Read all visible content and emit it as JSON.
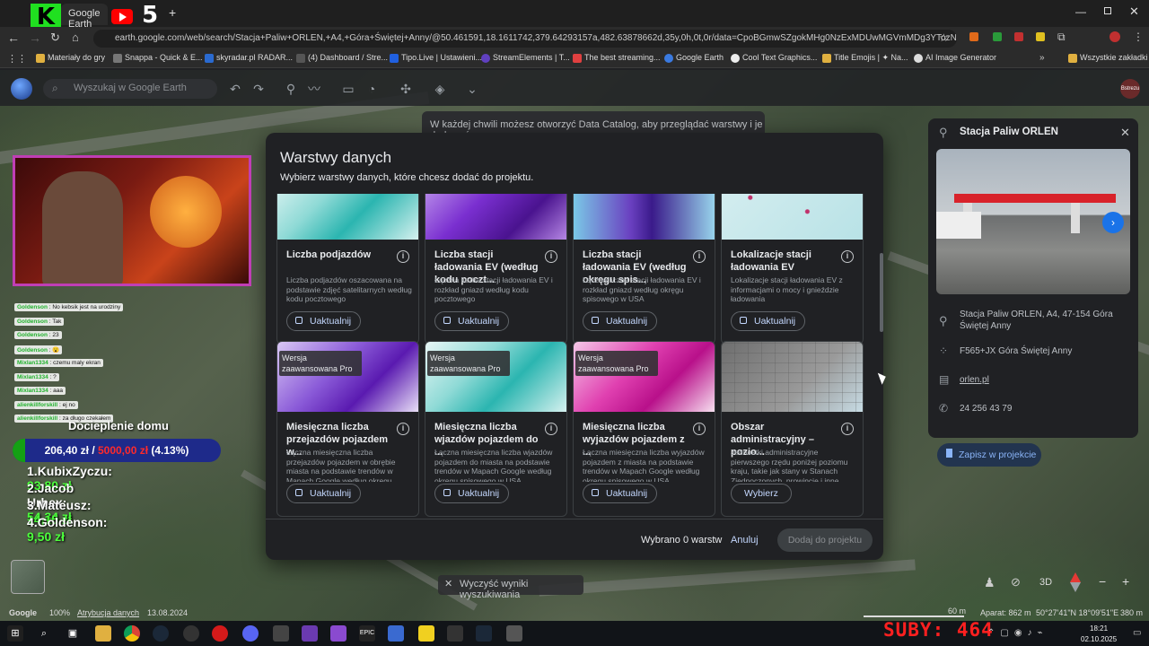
{
  "browser": {
    "tabs": [
      {
        "label": "Google Earth"
      },
      {
        "label": "5"
      }
    ],
    "url": "earth.google.com/web/search/Stacja+Paliw+ORLEN,+A4,+Góra+Świętej+Anny/@50.461591,18.1611742,379.64293157a,482.63878662d,35y,0h,0t,0r/data=CpoBGmwSZgokMHg0NzExMDUwMGVmMDg3YTozNjB4Yz...",
    "bookmarks": [
      "Materiały do gry",
      "Snappa - Quick & E...",
      "skyradar.pl RADAR...",
      "(4) Dashboard / Stre...",
      "Tipo.Live | Ustawieni...",
      "StreamElements | T...",
      "The best streaming...",
      "Google Earth",
      "Cool Text Graphics...",
      "Title Emojis | ✦ Na...",
      "AI Image Generator",
      "Wszystkie zakładki"
    ]
  },
  "earth": {
    "search_placeholder": "Wyszukaj w Google Earth",
    "toast": "W każdej chwili możesz otworzyć Data Catalog, aby przeglądać warstwy i je dodawać.",
    "clear_results": "Wyczyść wyniki wyszukiwania",
    "scale": "60 m",
    "bottom_left": {
      "logo": "Google",
      "zoom": "100%",
      "attribution": "Atrybucja danych",
      "date": "13.08.2024"
    },
    "status": {
      "altitude": "Aparat: 862 m",
      "coords": "50°27'41\"N 18°09'51\"E",
      "elev": "380 m"
    },
    "controls": {
      "mode3d": "3D"
    },
    "avatar": "Bstrezu"
  },
  "dialog": {
    "title": "Warstwy danych",
    "subtitle": "Wybierz warstwy danych, które chcesz dodać do projektu.",
    "selected_count": "Wybrano 0 warstw",
    "cancel_label": "Anuluj",
    "add_label": "Dodaj do projektu",
    "cards": [
      {
        "title": "Liczba podjazdów",
        "desc": "Liczba podjazdów oszacowana na podstawie zdjęć satelitarnych według kodu pocztowego",
        "button": "Uaktualnij",
        "pro": "",
        "palette": "teal"
      },
      {
        "title": "Liczba stacji ładowania EV (według kodu poczt...",
        "desc": "Łączna liczba stacji ładowania EV i rozkład gniazd według kodu pocztowego",
        "button": "Uaktualnij",
        "pro": "",
        "palette": "purple"
      },
      {
        "title": "Liczba stacji ładowania EV (według okręgu spis...",
        "desc": "Łączna liczba stacji ładowania EV i rozkład gniazd według okręgu spisowego w USA",
        "button": "Uaktualnij",
        "pro": "",
        "palette": "purpleblue"
      },
      {
        "title": "Lokalizacje stacji ładowania EV",
        "desc": "Lokalizacje stacji ładowania EV z informacjami o mocy i gnieździe ładowania",
        "button": "Uaktualnij",
        "pro": "",
        "palette": "dots"
      },
      {
        "title": "Miesięczna liczba przejazdów pojazdem w...",
        "desc": "Łączna miesięczna liczba przejazdów pojazdem w obrębie miasta na podstawie trendów w Mapach Google według okręgu spisowego w USA",
        "button": "Uaktualnij",
        "pro": "Wersja zaawansowana Pro",
        "palette": "violet"
      },
      {
        "title": "Miesięczna liczba wjazdów pojazdem do ...",
        "desc": "Łączna miesięczna liczba wjazdów pojazdem do miasta na podstawie trendów w Mapach Google według okręgu spisowego w USA",
        "button": "Uaktualnij",
        "pro": "Wersja zaawansowana Pro",
        "palette": "teal"
      },
      {
        "title": "Miesięczna liczba wyjazdów pojazdem z ...",
        "desc": "Łączna miesięczna liczba wyjazdów pojazdem z miasta na podstawie trendów w Mapach Google według okręgu spisowego w USA",
        "button": "Uaktualnij",
        "pro": "Wersja zaawansowana Pro",
        "palette": "magenta"
      },
      {
        "title": "Obszar administracyjny – pozio...",
        "desc": "Jednostki administracyjne pierwszego rzędu poniżej poziomu kraju, takie jak stany w Stanach Zjednoczonych, prowincje i inne obszary o zbliżonej",
        "button": "Wybierz",
        "pro": "",
        "palette": "map"
      }
    ]
  },
  "place": {
    "title": "Stacja Paliw ORLEN",
    "address": "Stacja Paliw ORLEN, A4, 47-154 Góra Świętej Anny",
    "pluscode": "F565+JX Góra Świętej Anny",
    "website": "orlen.pl",
    "phone": "24 256 43 79",
    "save": "Zapisz w projekcie"
  },
  "overlay": {
    "chat": [
      {
        "user": "Goldenson",
        "msg": "No kebsik jest na urodziny"
      },
      {
        "user": "Goldenson",
        "msg": "Tak"
      },
      {
        "user": "Goldenson",
        "msg": "23"
      },
      {
        "user": "Goldenson",
        "msg": "😮"
      },
      {
        "user": "Mixlan1334",
        "msg": "czemu maly ekran"
      },
      {
        "user": "Mixlan1334",
        "msg": "?"
      },
      {
        "user": "Mixlan1334",
        "msg": "aaa"
      },
      {
        "user": "alienkillforskill",
        "msg": "ej no"
      },
      {
        "user": "alienkillforskill",
        "msg": "za długo czekałem"
      }
    ],
    "goal_title": "Docieplenie domu",
    "goal_amount": "206,40 zł / ",
    "goal_target": "5000,00 zł",
    "goal_pct": " (4.13%)",
    "goal_fraction": 0.0413,
    "leaderboard": [
      {
        "rank": "1.",
        "name": "KubixZyczu: ",
        "amt": "93,80 zł"
      },
      {
        "rank": "2.",
        "name": "Jacob Urbex: ",
        "amt": "54,34 zł"
      },
      {
        "rank": "3.",
        "name": "Mateusz: ",
        "amt": "14,15 zł"
      },
      {
        "rank": "4.",
        "name": "Goldenson: ",
        "amt": "9,50 zł"
      }
    ],
    "subs": "SUBY: 464",
    "logo_k": "K",
    "logo_5": "5"
  },
  "taskbar": {
    "time": "18:21",
    "date": "02.10.2025"
  }
}
